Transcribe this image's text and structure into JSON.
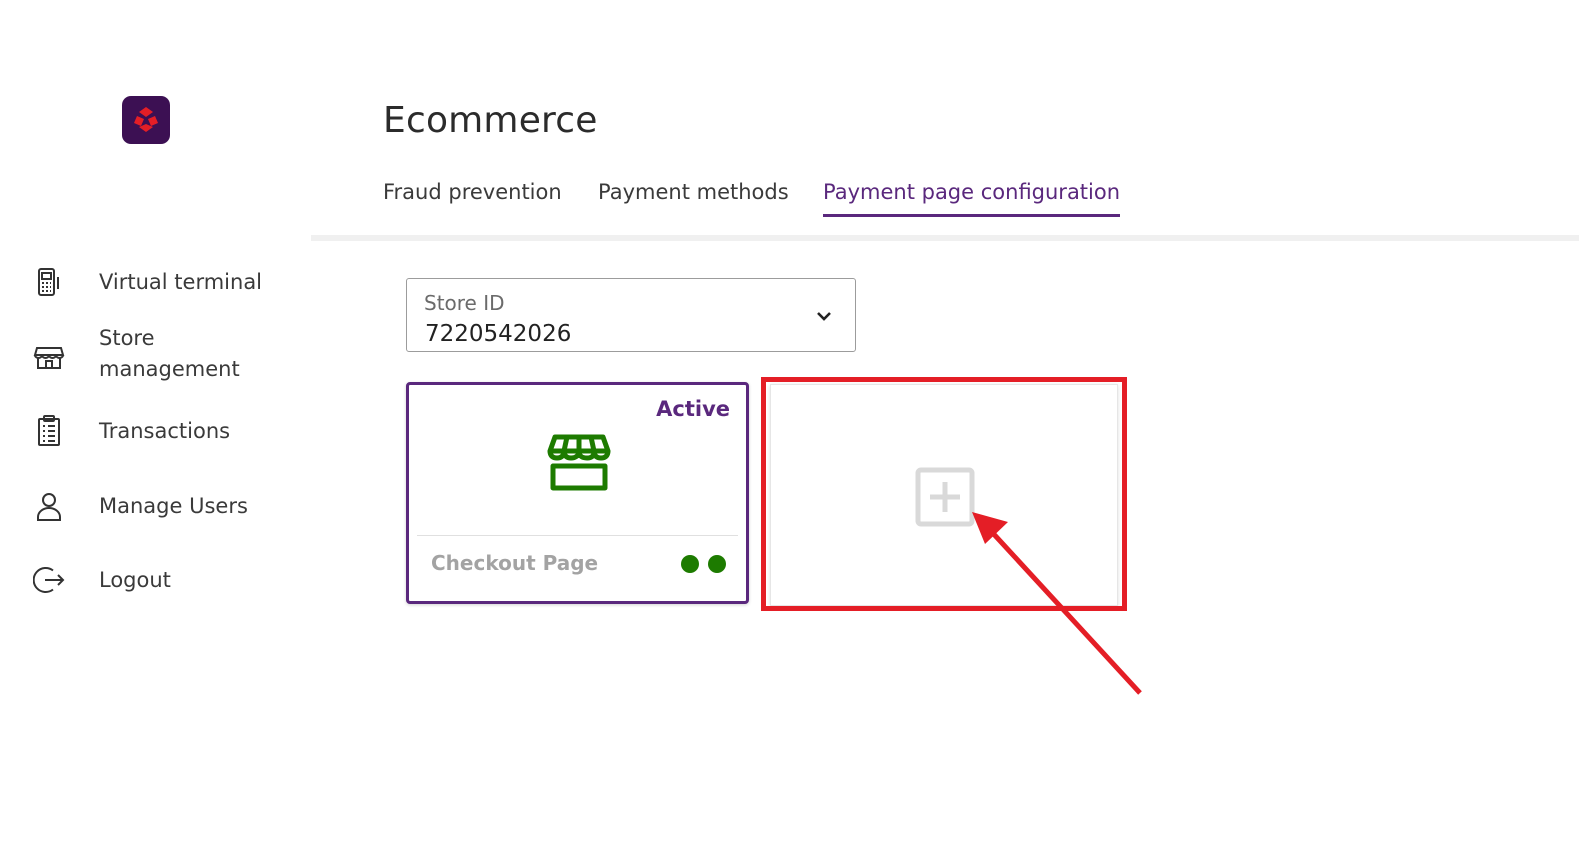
{
  "brand": {
    "logo_icon": "bank-logo-icon",
    "logo_color": "#3c1053",
    "accent_color": "#e41e26"
  },
  "sidebar": {
    "items": [
      {
        "id": "virtual-terminal",
        "label": "Virtual terminal",
        "icon": "card-terminal-icon"
      },
      {
        "id": "store-management",
        "label": "Store\nmanagement",
        "icon": "store-icon"
      },
      {
        "id": "transactions",
        "label": "Transactions",
        "icon": "clipboard-list-icon"
      },
      {
        "id": "manage-users",
        "label": "Manage Users",
        "icon": "user-icon"
      },
      {
        "id": "logout",
        "label": "Logout",
        "icon": "logout-icon"
      }
    ]
  },
  "main": {
    "title": "Ecommerce",
    "tabs": [
      {
        "label": "Fraud prevention",
        "active": false
      },
      {
        "label": "Payment methods",
        "active": false
      },
      {
        "label": "Payment page configuration",
        "active": true
      }
    ],
    "store_select": {
      "label": "Store ID",
      "value": "7220542026",
      "icon": "chevron-down-icon"
    },
    "cards": [
      {
        "name": "Checkout Page",
        "badge": "Active",
        "icon": "storefront-icon",
        "icon_color": "#1d7b00",
        "status_dots": 2,
        "border_color": "#5a287d"
      }
    ],
    "add_card": {
      "icon": "add-square-icon",
      "icon_color": "#d9d9d9"
    }
  },
  "annotation": {
    "highlight_color": "#e41e26",
    "arrow_color": "#e41e26"
  }
}
